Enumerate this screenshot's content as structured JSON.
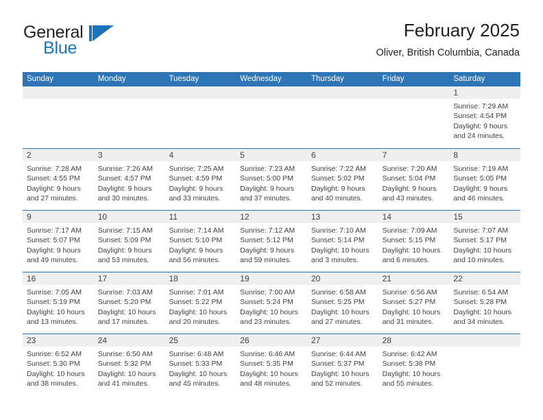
{
  "logo": {
    "word_top": "General",
    "word_bottom": "Blue",
    "mark": "triangle-flag",
    "brand_color": "#1b75bb"
  },
  "header": {
    "title": "February 2025",
    "subtitle": "Oliver, British Columbia, Canada"
  },
  "theme": {
    "header_blue": "#2e75b6",
    "daynum_band": "#efefef",
    "text": "#404040"
  },
  "weekdays": [
    "Sunday",
    "Monday",
    "Tuesday",
    "Wednesday",
    "Thursday",
    "Friday",
    "Saturday"
  ],
  "weeks": [
    [
      {
        "day": "",
        "sunrise": "",
        "sunset": "",
        "daylight1": "",
        "daylight2": "",
        "empty": true
      },
      {
        "day": "",
        "sunrise": "",
        "sunset": "",
        "daylight1": "",
        "daylight2": "",
        "empty": true
      },
      {
        "day": "",
        "sunrise": "",
        "sunset": "",
        "daylight1": "",
        "daylight2": "",
        "empty": true
      },
      {
        "day": "",
        "sunrise": "",
        "sunset": "",
        "daylight1": "",
        "daylight2": "",
        "empty": true
      },
      {
        "day": "",
        "sunrise": "",
        "sunset": "",
        "daylight1": "",
        "daylight2": "",
        "empty": true
      },
      {
        "day": "",
        "sunrise": "",
        "sunset": "",
        "daylight1": "",
        "daylight2": "",
        "empty": true
      },
      {
        "day": "1",
        "sunrise": "Sunrise: 7:29 AM",
        "sunset": "Sunset: 4:54 PM",
        "daylight1": "Daylight: 9 hours",
        "daylight2": "and 24 minutes.",
        "empty": false
      }
    ],
    [
      {
        "day": "2",
        "sunrise": "Sunrise: 7:28 AM",
        "sunset": "Sunset: 4:55 PM",
        "daylight1": "Daylight: 9 hours",
        "daylight2": "and 27 minutes.",
        "empty": false
      },
      {
        "day": "3",
        "sunrise": "Sunrise: 7:26 AM",
        "sunset": "Sunset: 4:57 PM",
        "daylight1": "Daylight: 9 hours",
        "daylight2": "and 30 minutes.",
        "empty": false
      },
      {
        "day": "4",
        "sunrise": "Sunrise: 7:25 AM",
        "sunset": "Sunset: 4:59 PM",
        "daylight1": "Daylight: 9 hours",
        "daylight2": "and 33 minutes.",
        "empty": false
      },
      {
        "day": "5",
        "sunrise": "Sunrise: 7:23 AM",
        "sunset": "Sunset: 5:00 PM",
        "daylight1": "Daylight: 9 hours",
        "daylight2": "and 37 minutes.",
        "empty": false
      },
      {
        "day": "6",
        "sunrise": "Sunrise: 7:22 AM",
        "sunset": "Sunset: 5:02 PM",
        "daylight1": "Daylight: 9 hours",
        "daylight2": "and 40 minutes.",
        "empty": false
      },
      {
        "day": "7",
        "sunrise": "Sunrise: 7:20 AM",
        "sunset": "Sunset: 5:04 PM",
        "daylight1": "Daylight: 9 hours",
        "daylight2": "and 43 minutes.",
        "empty": false
      },
      {
        "day": "8",
        "sunrise": "Sunrise: 7:19 AM",
        "sunset": "Sunset: 5:05 PM",
        "daylight1": "Daylight: 9 hours",
        "daylight2": "and 46 minutes.",
        "empty": false
      }
    ],
    [
      {
        "day": "9",
        "sunrise": "Sunrise: 7:17 AM",
        "sunset": "Sunset: 5:07 PM",
        "daylight1": "Daylight: 9 hours",
        "daylight2": "and 49 minutes.",
        "empty": false
      },
      {
        "day": "10",
        "sunrise": "Sunrise: 7:15 AM",
        "sunset": "Sunset: 5:09 PM",
        "daylight1": "Daylight: 9 hours",
        "daylight2": "and 53 minutes.",
        "empty": false
      },
      {
        "day": "11",
        "sunrise": "Sunrise: 7:14 AM",
        "sunset": "Sunset: 5:10 PM",
        "daylight1": "Daylight: 9 hours",
        "daylight2": "and 56 minutes.",
        "empty": false
      },
      {
        "day": "12",
        "sunrise": "Sunrise: 7:12 AM",
        "sunset": "Sunset: 5:12 PM",
        "daylight1": "Daylight: 9 hours",
        "daylight2": "and 59 minutes.",
        "empty": false
      },
      {
        "day": "13",
        "sunrise": "Sunrise: 7:10 AM",
        "sunset": "Sunset: 5:14 PM",
        "daylight1": "Daylight: 10 hours",
        "daylight2": "and 3 minutes.",
        "empty": false
      },
      {
        "day": "14",
        "sunrise": "Sunrise: 7:09 AM",
        "sunset": "Sunset: 5:15 PM",
        "daylight1": "Daylight: 10 hours",
        "daylight2": "and 6 minutes.",
        "empty": false
      },
      {
        "day": "15",
        "sunrise": "Sunrise: 7:07 AM",
        "sunset": "Sunset: 5:17 PM",
        "daylight1": "Daylight: 10 hours",
        "daylight2": "and 10 minutes.",
        "empty": false
      }
    ],
    [
      {
        "day": "16",
        "sunrise": "Sunrise: 7:05 AM",
        "sunset": "Sunset: 5:19 PM",
        "daylight1": "Daylight: 10 hours",
        "daylight2": "and 13 minutes.",
        "empty": false
      },
      {
        "day": "17",
        "sunrise": "Sunrise: 7:03 AM",
        "sunset": "Sunset: 5:20 PM",
        "daylight1": "Daylight: 10 hours",
        "daylight2": "and 17 minutes.",
        "empty": false
      },
      {
        "day": "18",
        "sunrise": "Sunrise: 7:01 AM",
        "sunset": "Sunset: 5:22 PM",
        "daylight1": "Daylight: 10 hours",
        "daylight2": "and 20 minutes.",
        "empty": false
      },
      {
        "day": "19",
        "sunrise": "Sunrise: 7:00 AM",
        "sunset": "Sunset: 5:24 PM",
        "daylight1": "Daylight: 10 hours",
        "daylight2": "and 23 minutes.",
        "empty": false
      },
      {
        "day": "20",
        "sunrise": "Sunrise: 6:58 AM",
        "sunset": "Sunset: 5:25 PM",
        "daylight1": "Daylight: 10 hours",
        "daylight2": "and 27 minutes.",
        "empty": false
      },
      {
        "day": "21",
        "sunrise": "Sunrise: 6:56 AM",
        "sunset": "Sunset: 5:27 PM",
        "daylight1": "Daylight: 10 hours",
        "daylight2": "and 31 minutes.",
        "empty": false
      },
      {
        "day": "22",
        "sunrise": "Sunrise: 6:54 AM",
        "sunset": "Sunset: 5:28 PM",
        "daylight1": "Daylight: 10 hours",
        "daylight2": "and 34 minutes.",
        "empty": false
      }
    ],
    [
      {
        "day": "23",
        "sunrise": "Sunrise: 6:52 AM",
        "sunset": "Sunset: 5:30 PM",
        "daylight1": "Daylight: 10 hours",
        "daylight2": "and 38 minutes.",
        "empty": false
      },
      {
        "day": "24",
        "sunrise": "Sunrise: 6:50 AM",
        "sunset": "Sunset: 5:32 PM",
        "daylight1": "Daylight: 10 hours",
        "daylight2": "and 41 minutes.",
        "empty": false
      },
      {
        "day": "25",
        "sunrise": "Sunrise: 6:48 AM",
        "sunset": "Sunset: 5:33 PM",
        "daylight1": "Daylight: 10 hours",
        "daylight2": "and 45 minutes.",
        "empty": false
      },
      {
        "day": "26",
        "sunrise": "Sunrise: 6:46 AM",
        "sunset": "Sunset: 5:35 PM",
        "daylight1": "Daylight: 10 hours",
        "daylight2": "and 48 minutes.",
        "empty": false
      },
      {
        "day": "27",
        "sunrise": "Sunrise: 6:44 AM",
        "sunset": "Sunset: 5:37 PM",
        "daylight1": "Daylight: 10 hours",
        "daylight2": "and 52 minutes.",
        "empty": false
      },
      {
        "day": "28",
        "sunrise": "Sunrise: 6:42 AM",
        "sunset": "Sunset: 5:38 PM",
        "daylight1": "Daylight: 10 hours",
        "daylight2": "and 55 minutes.",
        "empty": false
      },
      {
        "day": "",
        "sunrise": "",
        "sunset": "",
        "daylight1": "",
        "daylight2": "",
        "empty": true
      }
    ]
  ]
}
